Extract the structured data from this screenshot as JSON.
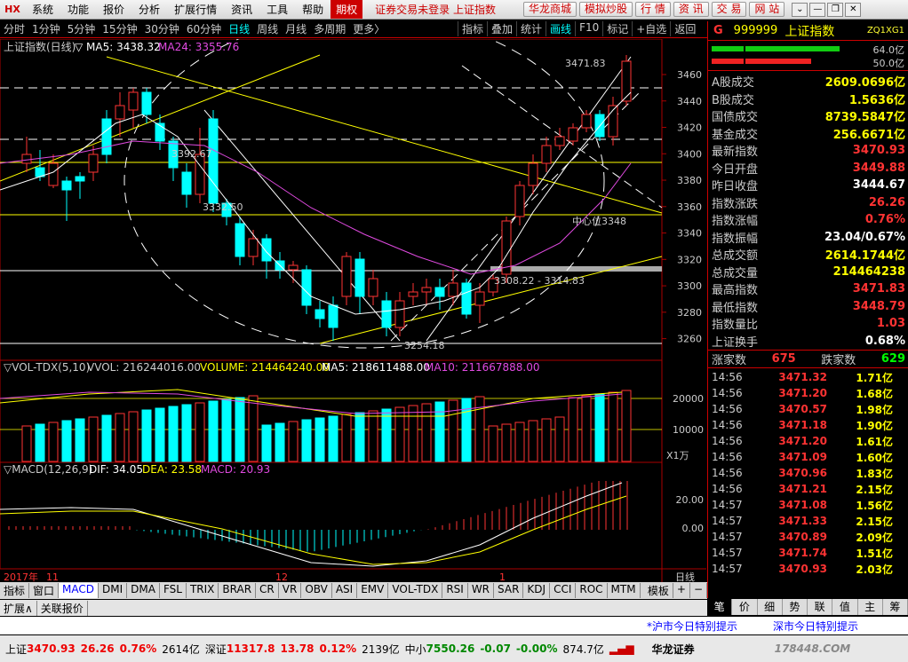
{
  "app": {
    "logo": "HX"
  },
  "menu": [
    "系统",
    "功能",
    "报价",
    "分析",
    "扩展行情",
    "资讯",
    "工具",
    "帮助"
  ],
  "menu_active": "期权",
  "status_text": "证券交易未登录 上证指数",
  "top_buttons": [
    "华龙商城",
    "模拟炒股",
    "行 情",
    "资 讯",
    "交 易",
    "网 站"
  ],
  "window_controls": [
    "⌄",
    "—",
    "❐",
    "✕"
  ],
  "periods": [
    "分时",
    "1分钟",
    "5分钟",
    "15分钟",
    "30分钟",
    "60分钟",
    "日线",
    "周线",
    "月线",
    "多周期",
    "更多〉"
  ],
  "period_selected": "日线",
  "chart_buttons": [
    "指标",
    "叠加",
    "统计",
    "画线",
    "F10",
    "标记",
    "+自选",
    "返回"
  ],
  "chart_buttons_selected": "画线",
  "main_legend": {
    "title": "上证指数(日线)",
    "ma5": "▽ MA5: 3438.32",
    "ma24": "MA24: 3355.76"
  },
  "annotations": {
    "high": "3471.83",
    "a1": "3392.67",
    "a2": "3332.50",
    "center": "中心位3348",
    "range": "3308.22 - 3314.83",
    "low": "3254.18"
  },
  "price_axis": [
    "3460",
    "3440",
    "3420",
    "3400",
    "3380",
    "3360",
    "3340",
    "3320",
    "3300",
    "3280",
    "3260"
  ],
  "vol_legend": {
    "name": "▽VOL-TDX(5,10)",
    "vvol": "VVOL: 216244016.00",
    "volume": "VOLUME: 214464240.00",
    "ma5": "MA5: 218611488.00",
    "ma10": "MA10: 211667888.00"
  },
  "vol_axis": [
    "20000",
    "10000"
  ],
  "vol_unit": "X1万",
  "macd_legend": {
    "name": "▽MACD(12,26,9)",
    "dif": "DIF: 34.05",
    "dea": "DEA: 23.58",
    "macd": "MACD: 20.93"
  },
  "macd_axis": [
    "20.00",
    "0.00"
  ],
  "date_axis": {
    "year": "2017年",
    "m11": "11",
    "m12": "12",
    "m1": "1",
    "period": "日线"
  },
  "indicator_tabs": [
    "指标",
    "窗口",
    "MACD",
    "DMI",
    "DMA",
    "FSL",
    "TRIX",
    "BRAR",
    "CR",
    "VR",
    "OBV",
    "ASI",
    "EMV",
    "VOL-TDX",
    "RSI",
    "WR",
    "SAR",
    "KDJ",
    "CCI",
    "ROC",
    "MTM"
  ],
  "indicator_selected": "MACD",
  "indicator_right": [
    "模板",
    "+",
    "−"
  ],
  "ext_tabs": [
    "扩展∧",
    "关联报价"
  ],
  "quote": {
    "code": "999999",
    "name": "上证指数",
    "ext": "ZQ1XG1",
    "bar_labels": [
      "64.0亿",
      "50.0亿"
    ],
    "rows": [
      {
        "label": "A股成交",
        "value": "2609.0696亿",
        "color": "#ffff00"
      },
      {
        "label": "B股成交",
        "value": "1.5636亿",
        "color": "#ffff00"
      },
      {
        "label": "国债成交",
        "value": "8739.5847亿",
        "color": "#ffff00"
      },
      {
        "label": "基金成交",
        "value": "256.6671亿",
        "color": "#ffff00"
      },
      {
        "label": "最新指数",
        "value": "3470.93",
        "color": "#ff3333"
      },
      {
        "label": "今日开盘",
        "value": "3449.88",
        "color": "#ff3333"
      },
      {
        "label": "昨日收盘",
        "value": "3444.67",
        "color": "#ffffff"
      },
      {
        "label": "指数涨跌",
        "value": "26.26",
        "color": "#ff3333"
      },
      {
        "label": "指数涨幅",
        "value": "0.76%",
        "color": "#ff3333"
      },
      {
        "label": "指数振幅",
        "value": "23.04/0.67%",
        "color": "#ffffff"
      },
      {
        "label": "总成交额",
        "value": "2614.1744亿",
        "color": "#ffff00"
      },
      {
        "label": "总成交量",
        "value": "214464238",
        "color": "#ffff00"
      },
      {
        "label": "最高指数",
        "value": "3471.83",
        "color": "#ff3333"
      },
      {
        "label": "最低指数",
        "value": "3448.79",
        "color": "#ff3333"
      },
      {
        "label": "指数量比",
        "value": "1.03",
        "color": "#ff3333"
      },
      {
        "label": "上证换手",
        "value": "0.68%",
        "color": "#ffffff"
      }
    ],
    "up_label": "涨家数",
    "up": "675",
    "down_label": "跌家数",
    "down": "629",
    "ticks": [
      {
        "t": "14:56",
        "p": "3471.32",
        "v": "1.71亿"
      },
      {
        "t": "14:56",
        "p": "3471.20",
        "v": "1.68亿"
      },
      {
        "t": "14:56",
        "p": "3470.57",
        "v": "1.98亿"
      },
      {
        "t": "14:56",
        "p": "3471.18",
        "v": "1.90亿"
      },
      {
        "t": "14:56",
        "p": "3471.20",
        "v": "1.61亿"
      },
      {
        "t": "14:56",
        "p": "3471.09",
        "v": "1.60亿"
      },
      {
        "t": "14:56",
        "p": "3470.96",
        "v": "1.83亿"
      },
      {
        "t": "14:56",
        "p": "3471.21",
        "v": "2.15亿"
      },
      {
        "t": "14:57",
        "p": "3471.08",
        "v": "1.56亿"
      },
      {
        "t": "14:57",
        "p": "3471.33",
        "v": "2.15亿"
      },
      {
        "t": "14:57",
        "p": "3470.89",
        "v": "2.09亿"
      },
      {
        "t": "14:57",
        "p": "3471.74",
        "v": "1.51亿"
      },
      {
        "t": "14:57",
        "p": "3470.93",
        "v": "2.03亿"
      }
    ],
    "tabs": [
      "笔",
      "价",
      "细",
      "势",
      "联",
      "值",
      "主",
      "筹"
    ]
  },
  "notes": {
    "left": "*沪市今日特别提示",
    "right": "深市今日特别提示"
  },
  "ticker": {
    "sh_label": "上证",
    "sh": "3470.93",
    "sh_chg": "26.26",
    "sh_pct": "0.76%",
    "sh_amt": "2614亿",
    "sz_label": "深证",
    "sz": "11317.8",
    "sz_chg": "13.78",
    "sz_pct": "0.12%",
    "sz_amt": "2139亿",
    "zx_label": "中小",
    "zx": "7550.26",
    "zx_chg": "-0.07",
    "zx_pct": "-0.00%",
    "zx_amt": "874.7亿",
    "broker": "华龙证券",
    "watermark": "178448.COM"
  },
  "colors": {
    "up": "#ff3333",
    "down": "#00ffff",
    "accent": "#cc0000"
  }
}
